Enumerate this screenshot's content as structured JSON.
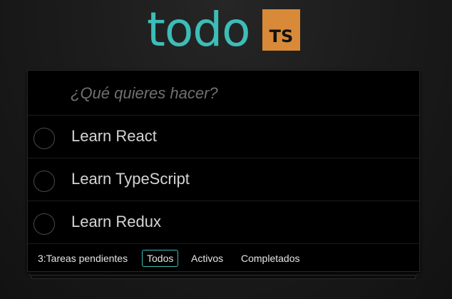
{
  "header": {
    "logo_text": "todo",
    "logo_badge": "TS"
  },
  "new_todo": {
    "placeholder": "¿Qué quieres hacer?",
    "value": ""
  },
  "todos": [
    {
      "label": "Learn React",
      "completed": false
    },
    {
      "label": "Learn TypeScript",
      "completed": false
    },
    {
      "label": "Learn Redux",
      "completed": false
    }
  ],
  "footer": {
    "count_text": "3:Tareas pendientes",
    "filters": [
      {
        "label": "Todos",
        "selected": true
      },
      {
        "label": "Activos",
        "selected": false
      },
      {
        "label": "Completados",
        "selected": false
      }
    ]
  },
  "colors": {
    "brand_teal": "#3dbdb7",
    "badge_orange": "#d88a38"
  }
}
